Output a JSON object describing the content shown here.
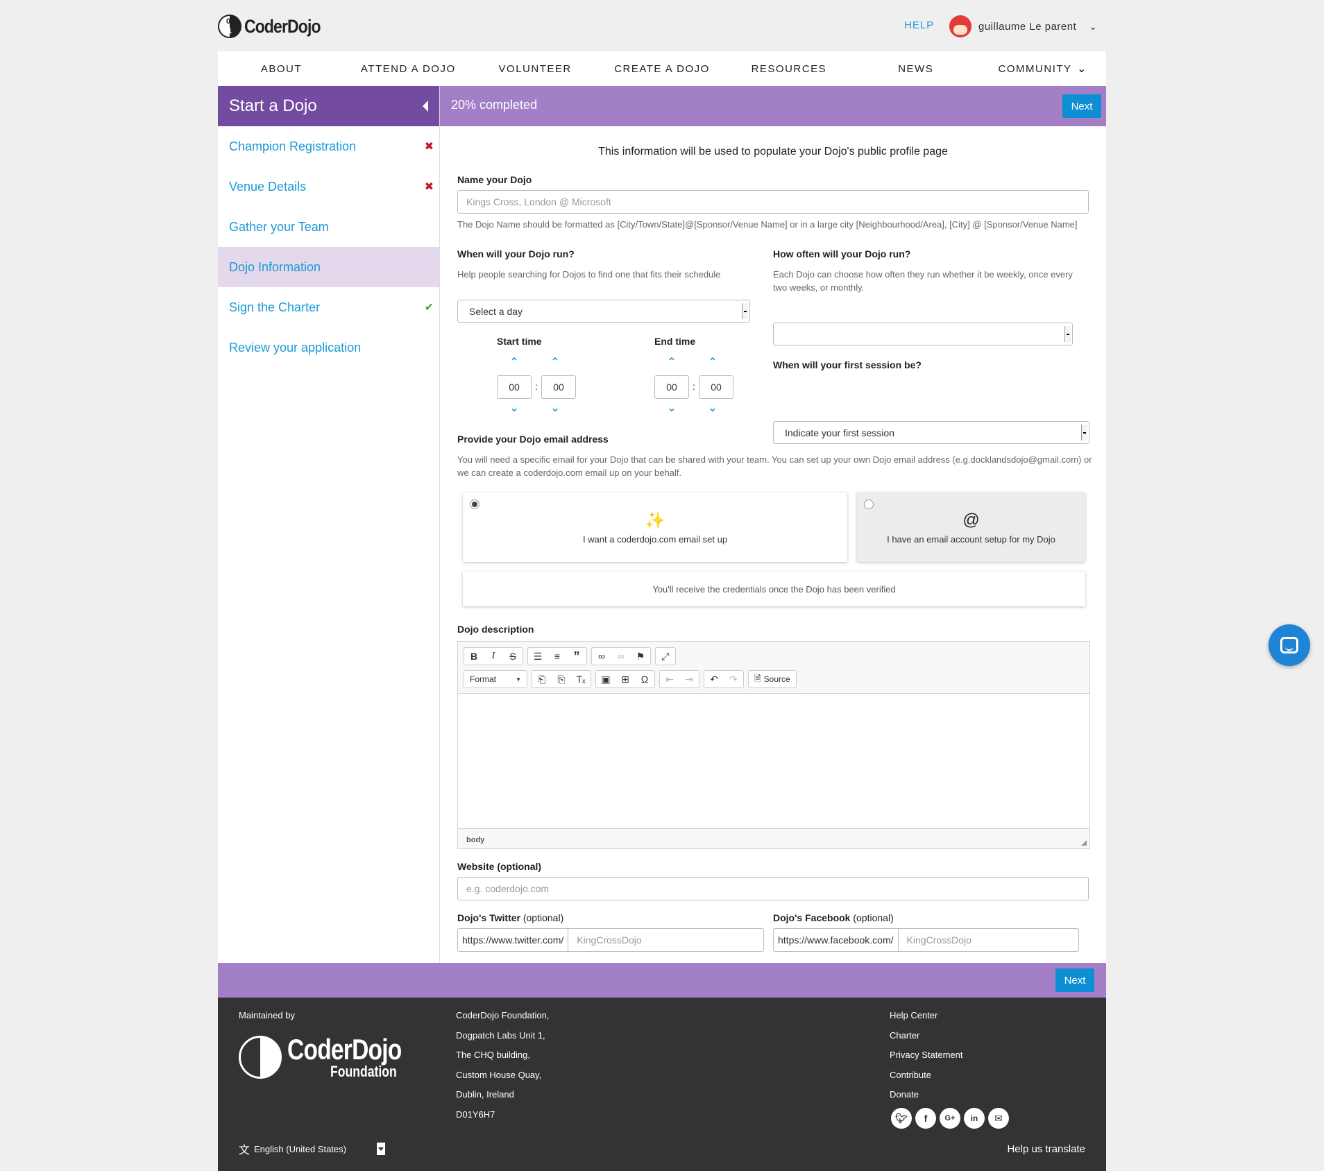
{
  "header": {
    "logo_text": "CoderDojo",
    "help": "HELP",
    "user_name": "guillaume Le parent"
  },
  "nav": [
    "ABOUT",
    "ATTEND A DOJO",
    "VOLUNTEER",
    "CREATE A DOJO",
    "RESOURCES",
    "NEWS",
    "COMMUNITY"
  ],
  "sidebar": {
    "title": "Start a Dojo",
    "items": [
      {
        "label": "Champion Registration",
        "status": "error"
      },
      {
        "label": "Venue Details",
        "status": "error"
      },
      {
        "label": "Gather your Team",
        "status": "none"
      },
      {
        "label": "Dojo Information",
        "status": "active"
      },
      {
        "label": "Sign the Charter",
        "status": "done"
      },
      {
        "label": "Review your application",
        "status": "none"
      }
    ]
  },
  "progress": {
    "text": "20% completed",
    "value": 20
  },
  "buttons": {
    "next": "Next"
  },
  "form": {
    "intro": "This information will be used to populate your Dojo's public profile page",
    "name": {
      "label": "Name your Dojo",
      "placeholder": "Kings Cross, London @ Microsoft",
      "hint": "The Dojo Name should be formatted as [City/Town/State]@[Sponsor/Venue Name] or in a large city [Neighbourhood/Area], [City] @ [Sponsor/Venue Name]"
    },
    "when": {
      "label": "When will your Dojo run?",
      "hint": "Help people searching for Dojos to find one that fits their schedule",
      "select": "Select a day"
    },
    "often": {
      "label": "How often will your Dojo run?",
      "hint": "Each Dojo can choose how often they run whether it be weekly, once every two weeks, or monthly.",
      "select": ""
    },
    "start_time": {
      "label": "Start time",
      "hour": "00",
      "minute": "00"
    },
    "end_time": {
      "label": "End time",
      "hour": "00",
      "minute": "00"
    },
    "time_sep": ":",
    "first_session": {
      "label": "When will your first session be?",
      "select": "Indicate your first session"
    },
    "email": {
      "label": "Provide your Dojo email address",
      "hint": "You will need a specific email for your Dojo that can be shared with your team.  You can set up your own Dojo email address (e.g.docklandsdojo@gmail.com) or we can create a coderdojo.com email up on your behalf.",
      "option_a": "I want a coderdojo.com email set up",
      "option_b": "I have an email account setup for my Dojo",
      "option_b_icon": "@",
      "note": "You'll receive the credentials once the Dojo has been verified",
      "selected": "option_a"
    },
    "description": {
      "label": "Dojo description",
      "format": "Format",
      "source": "Source",
      "path": "body"
    },
    "website": {
      "label": "Website (optional)",
      "placeholder": "e.g. coderdojo.com"
    },
    "twitter": {
      "label": "Dojo's Twitter",
      "optional": "(optional)",
      "prefix": "https://www.twitter.com/",
      "placeholder": "KingCrossDojo"
    },
    "facebook": {
      "label": "Dojo's Facebook",
      "optional": "(optional)",
      "prefix": "https://www.facebook.com/",
      "placeholder": "KingCrossDojo"
    }
  },
  "footer": {
    "maintained": "Maintained by",
    "logo_line1": "CoderDojo",
    "logo_line2": "Foundation",
    "address": [
      "CoderDojo Foundation,",
      "Dogpatch Labs Unit 1,",
      "The CHQ building,",
      "Custom House Quay,",
      "Dublin, Ireland",
      "D01Y6H7"
    ],
    "links": [
      "Help Center",
      "Charter",
      "Privacy Statement",
      "Contribute",
      "Donate"
    ],
    "language": "English (United States)",
    "translate": "Help us translate"
  }
}
